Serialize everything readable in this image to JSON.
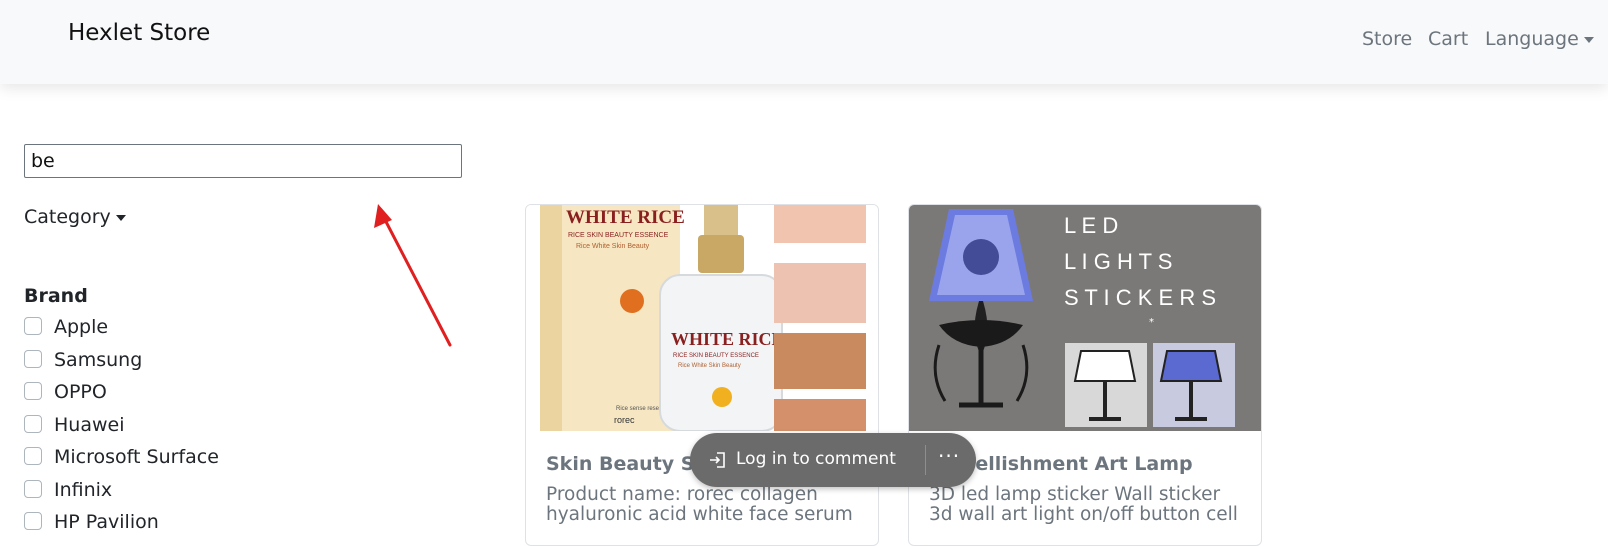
{
  "navbar": {
    "brand": "Hexlet Store",
    "links": [
      {
        "label": "Store"
      },
      {
        "label": "Cart"
      },
      {
        "label": "Language"
      }
    ]
  },
  "filters": {
    "search_value": "be",
    "category_label": "Category",
    "brand_heading": "Brand",
    "brands": [
      "Apple",
      "Samsung",
      "OPPO",
      "Huawei",
      "Microsoft Surface",
      "Infinix",
      "HP Pavilion"
    ]
  },
  "products": [
    {
      "title": "Skin Beauty Serum",
      "description": "Product name: rorec collagen hyaluronic acid white face serum",
      "image_text": {
        "line1": "WHITE RICE",
        "line2": "RICE SKIN BEAUTY ESSENCE",
        "line3": "Rice White Skin Beauty",
        "bottle_label": "WHITE RICE",
        "bottle_sub": "RICE SKIN BEAUTY ESSENCE",
        "bottle_sub2": "Rice White Skin Beauty",
        "box_small": "Rice sense reset",
        "brand_mark": "rorec"
      }
    },
    {
      "title": "Embellishment Art Lamp",
      "description": "3D led lamp sticker Wall sticker 3d wall art light on/off button cell",
      "image_text": {
        "line1": "L E D",
        "line2": "L I G H T S",
        "line3": "S T I C K E R S"
      }
    }
  ],
  "toast": {
    "label": "Log in to comment",
    "more": "···"
  },
  "colors": {
    "navbar_bg": "#f8f9fa",
    "toast_bg": "#6b6b6b",
    "annotation_arrow": "#e02020"
  }
}
